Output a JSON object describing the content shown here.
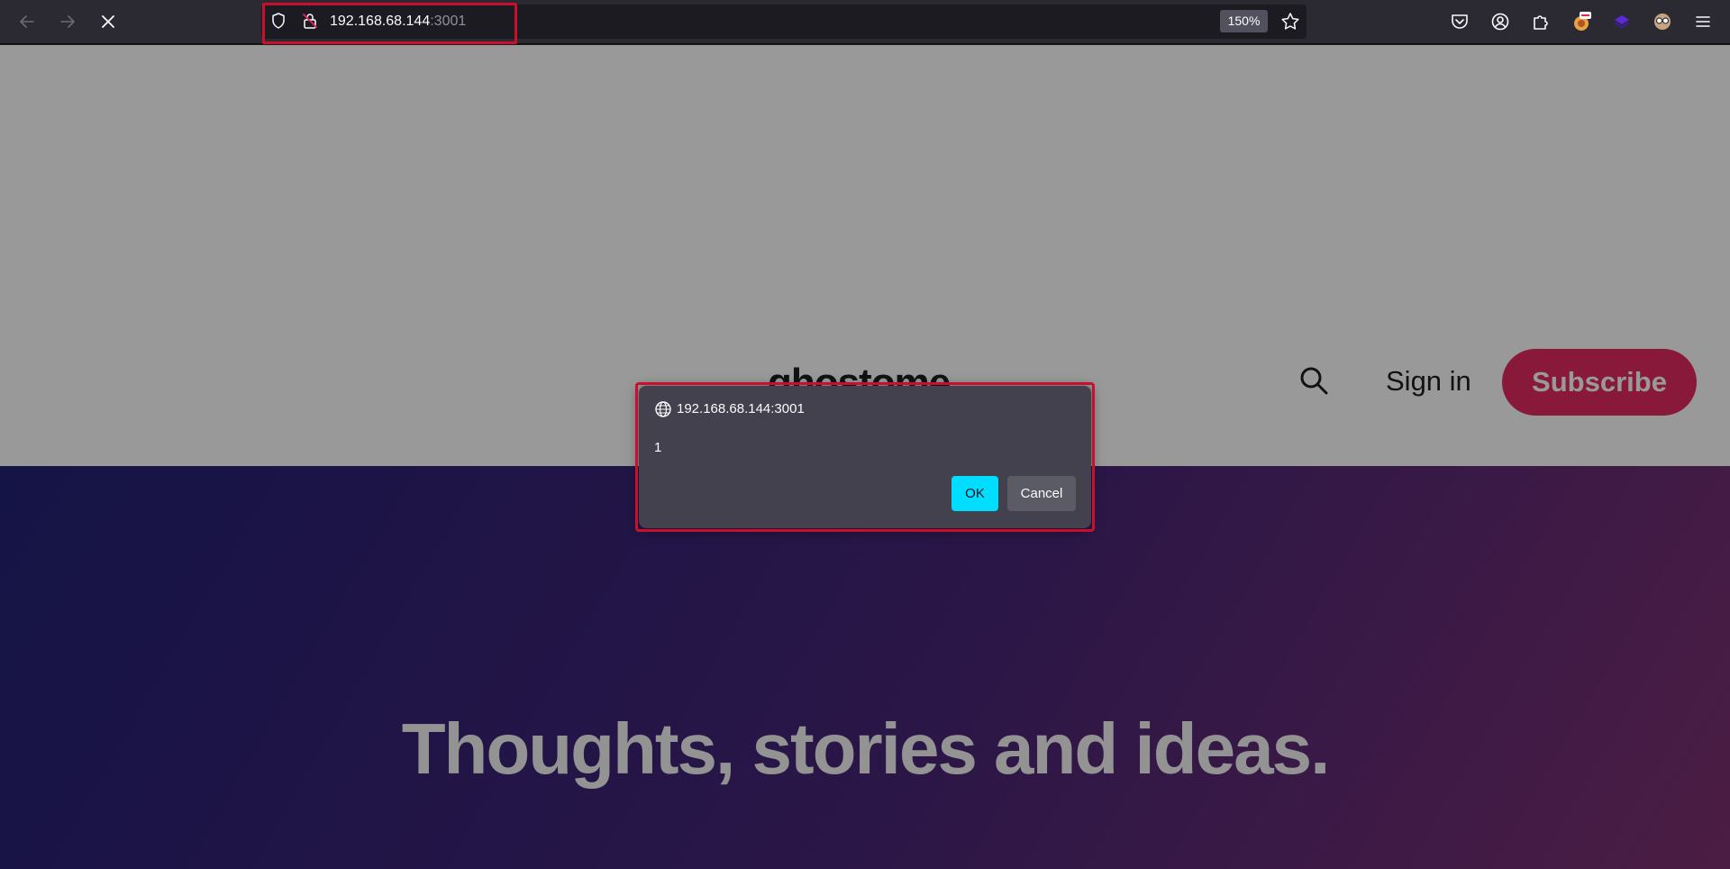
{
  "browser": {
    "url_host": "192.168.68.144",
    "url_port": ":3001",
    "zoom": "150%",
    "icons": {
      "back": "arrow-left-icon",
      "forward": "arrow-right-icon",
      "stop": "close-icon",
      "shield": "shield-icon",
      "lock": "insecure-lock-icon",
      "bookmark": "star-icon",
      "pocket": "pocket-icon",
      "account": "account-icon",
      "extensions": "puzzle-icon",
      "menu": "hamburger-menu-icon"
    }
  },
  "site": {
    "title": "ghostome",
    "signin_label": "Sign in",
    "subscribe_label": "Subscribe",
    "hero_title": "Thoughts, stories and ideas.",
    "colors": {
      "accent": "#e3245c",
      "hero_start": "#1c1a71",
      "hero_end": "#7a2a6d"
    }
  },
  "dialog": {
    "origin": "192.168.68.144:3001",
    "message": "1",
    "ok_label": "OK",
    "cancel_label": "Cancel"
  }
}
